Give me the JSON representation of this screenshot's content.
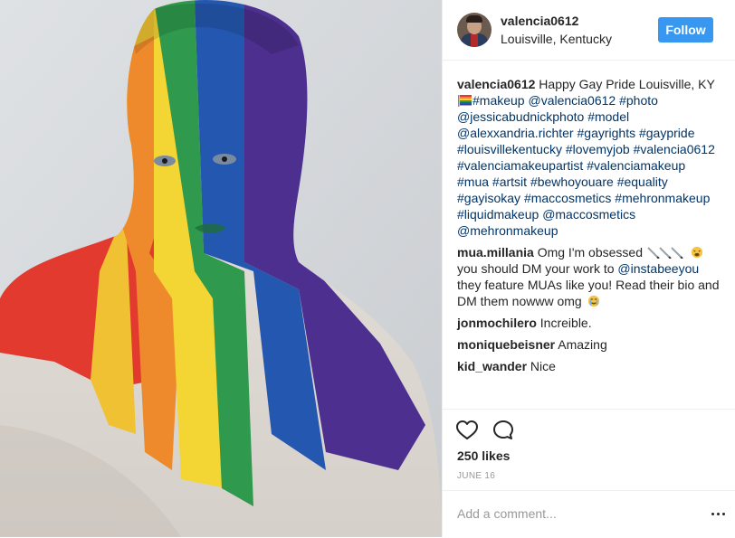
{
  "post": {
    "username": "valencia0612",
    "location": "Louisville, Kentucky",
    "follow_label": "Follow"
  },
  "caption": {
    "username": "valencia0612",
    "text_start": "Happy Gay Pride Louisville, KY",
    "tags": [
      "#makeup",
      "@valencia0612",
      "#photo",
      "@jessicabudnickphoto",
      "#model",
      "@alexxandria.richter",
      "#gayrights",
      "#gaypride",
      "#louisvillekentucky",
      "#lovemyjob",
      "#valencia0612",
      "#valenciamakeupartist",
      "#valenciamakeup",
      "#mua",
      "#artsit",
      "#bewhoyouare",
      "#equality",
      "#gayisokay",
      "#maccosmetics",
      "#mehronmakeup",
      "#liquidmakeup",
      "@maccosmetics",
      "@mehronmakeup"
    ]
  },
  "comments": [
    {
      "username": "mua.millania",
      "part1": "Omg I'm obsessed",
      "part2": "you should DM your work to",
      "mention": "@instabeeyou",
      "part3": "they feature MUAs like you! Read their bio and DM them nowww omg"
    },
    {
      "username": "jonmochilero",
      "text": "Increible."
    },
    {
      "username": "moniquebeisner",
      "text": "Amazing"
    },
    {
      "username": "kid_wander",
      "text": "Nice"
    }
  ],
  "likes": "250 likes",
  "date": "JUNE 16",
  "add_comment_placeholder": "Add a comment...",
  "icons": {
    "like": "heart-outline-icon",
    "comment": "speech-bubble-icon",
    "more": "more-dots-icon",
    "flag": "rainbow-flag-emoji"
  },
  "colors": {
    "follow_bg": "#3897f0",
    "hashtag": "#003569",
    "muted": "#999999"
  }
}
